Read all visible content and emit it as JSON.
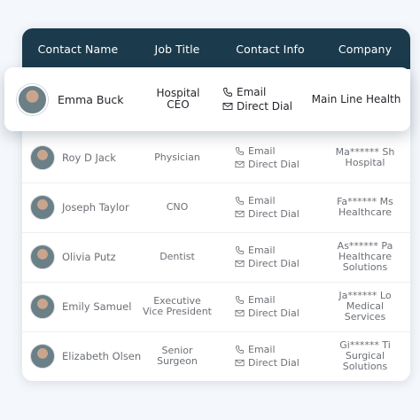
{
  "table": {
    "headers": [
      "Contact Name",
      "Job Title",
      "Contact Info",
      "Company"
    ],
    "contact_labels": {
      "email": "Email",
      "direct_dial": "Direct Dial"
    },
    "rows": [
      {
        "name": "Emma Buck",
        "title": [
          "Hospital",
          "CEO"
        ],
        "company": [
          "Main Line Health"
        ]
      },
      {
        "name": "Roy D Jack",
        "title": [
          "Physician"
        ],
        "company": [
          "Ma****** Sh",
          "Hospital"
        ]
      },
      {
        "name": "Joseph Taylor",
        "title": [
          "CNO"
        ],
        "company": [
          "Fa****** Ms",
          "Healthcare"
        ]
      },
      {
        "name": "Olivia Putz",
        "title": [
          "Dentist"
        ],
        "company": [
          "As****** Pa",
          "Healthcare",
          "Solutions"
        ]
      },
      {
        "name": "Emily Samuel",
        "title": [
          "Executive",
          "Vice President"
        ],
        "company": [
          "Ja****** Lo",
          "Medical",
          "Services"
        ]
      },
      {
        "name": "Elizabeth Olsen",
        "title": [
          "Senior",
          "Surgeon"
        ],
        "company": [
          "Gi****** Ti",
          "Surgical",
          "Solutions"
        ]
      }
    ]
  },
  "colors": {
    "header_bg": "#1b3a4b",
    "header_text": "#ffffff",
    "muted_text": "#6b6f75",
    "strong_text": "#1f2227"
  }
}
